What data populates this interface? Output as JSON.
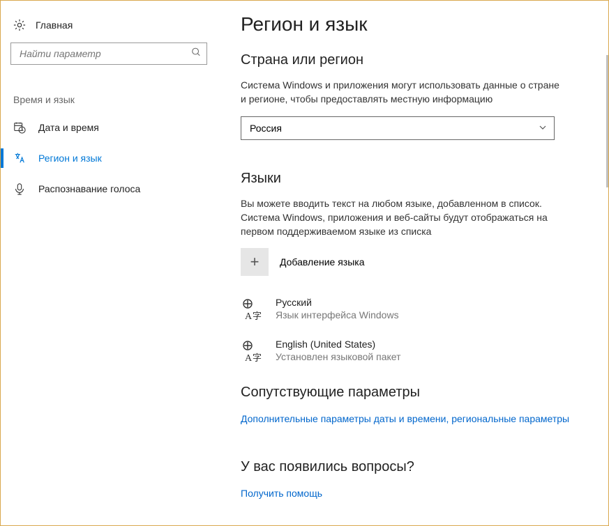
{
  "sidebar": {
    "home": "Главная",
    "search_placeholder": "Найти параметр",
    "section": "Время и язык",
    "items": [
      {
        "label": "Дата и время"
      },
      {
        "label": "Регион и язык"
      },
      {
        "label": "Распознавание голоса"
      }
    ]
  },
  "main": {
    "title": "Регион и язык",
    "region": {
      "heading": "Страна или регион",
      "desc": "Система Windows и приложения могут использовать данные о стране и регионе, чтобы предоставлять местную информацию",
      "selected": "Россия"
    },
    "languages": {
      "heading": "Языки",
      "desc": "Вы можете вводить текст на любом языке, добавленном в список. Система Windows, приложения и веб-сайты будут отображаться на первом поддерживаемом языке из списка",
      "add_label": "Добавление языка",
      "items": [
        {
          "name": "Русский",
          "status": "Язык интерфейса Windows"
        },
        {
          "name": "English (United States)",
          "status": "Установлен языковой пакет"
        }
      ]
    },
    "related": {
      "heading": "Сопутствующие параметры",
      "link": "Дополнительные параметры даты и времени, региональные параметры"
    },
    "questions": {
      "heading": "У вас появились вопросы?",
      "link": "Получить помощь"
    }
  }
}
